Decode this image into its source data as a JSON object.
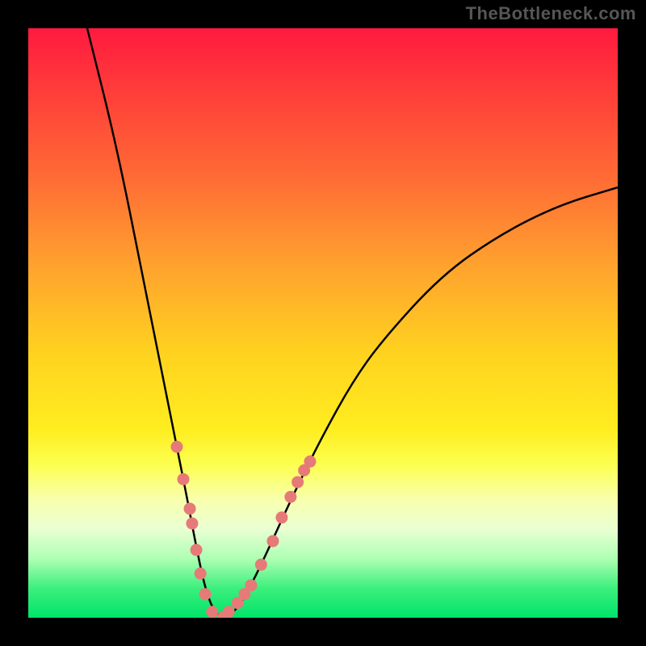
{
  "watermark": "TheBottleneck.com",
  "chart_data": {
    "type": "line",
    "title": "",
    "xlabel": "",
    "ylabel": "",
    "xlim": [
      0,
      100
    ],
    "ylim": [
      0,
      100
    ],
    "grid": false,
    "legend": false,
    "series": [
      {
        "name": "curve",
        "color": "#000000",
        "x": [
          10,
          15,
          20,
          23,
          25,
          27,
          28.5,
          30,
          31.5,
          33,
          35,
          37,
          40,
          45,
          50,
          55,
          60,
          70,
          80,
          90,
          100
        ],
        "y": [
          100,
          80,
          55,
          40,
          30,
          20,
          12,
          5,
          1,
          0,
          1,
          4,
          10,
          21,
          31,
          40,
          47,
          58,
          65,
          70,
          73
        ]
      },
      {
        "name": "dots-left",
        "type": "scatter",
        "color": "#e67a78",
        "x": [
          25.2,
          26.3,
          27.4,
          27.8,
          28.5,
          29.2,
          30.0,
          31.2
        ],
        "y": [
          29.0,
          23.5,
          18.5,
          16.0,
          11.5,
          7.5,
          4.0,
          1.0
        ]
      },
      {
        "name": "dots-right",
        "type": "scatter",
        "color": "#e67a78",
        "x": [
          33.0,
          34.0,
          35.5,
          36.7,
          37.8,
          39.5,
          41.5,
          43.0,
          44.5,
          45.7,
          46.8,
          47.8
        ],
        "y": [
          0.0,
          1.0,
          2.5,
          4.0,
          5.5,
          9.0,
          13.0,
          17.0,
          20.5,
          23.0,
          25.0,
          26.5
        ]
      }
    ],
    "gradient_stops": [
      {
        "pos": 0.0,
        "color": "#ff1a3f"
      },
      {
        "pos": 0.25,
        "color": "#ff6a35"
      },
      {
        "pos": 0.55,
        "color": "#ffd21f"
      },
      {
        "pos": 0.8,
        "color": "#f8ffae"
      },
      {
        "pos": 1.0,
        "color": "#00e46a"
      }
    ]
  }
}
